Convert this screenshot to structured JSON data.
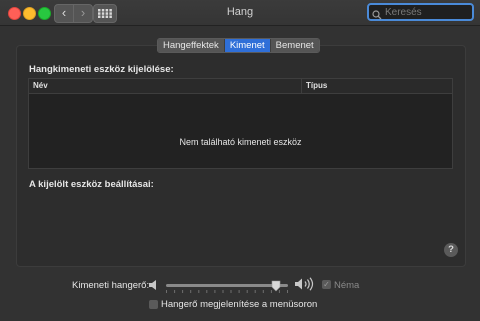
{
  "window": {
    "title": "Hang"
  },
  "search": {
    "placeholder": "Keresés",
    "value": ""
  },
  "tabs": [
    {
      "label": "Hangeffektek",
      "active": false
    },
    {
      "label": "Kimenet",
      "active": true
    },
    {
      "label": "Bemenet",
      "active": false
    }
  ],
  "output": {
    "section_title": "Hangkimeneti eszköz kijelölése:",
    "columns": [
      "Név",
      "Típus"
    ],
    "empty_message": "Nem található kimeneti eszköz",
    "settings_title": "A kijelölt eszköz beállításai:"
  },
  "help": {
    "label": "?"
  },
  "volume": {
    "label": "Kimeneti hangerő:",
    "level": 0.9,
    "mute_label": "Néma",
    "mute_checked": true,
    "show_in_menubar_label": "Hangerő megjelenítése a menüsoron",
    "show_in_menubar_checked": false
  },
  "colors": {
    "accent": "#2f6fd8",
    "close": "#ff5f57",
    "minimize": "#febc2e",
    "maximize": "#28c840"
  }
}
